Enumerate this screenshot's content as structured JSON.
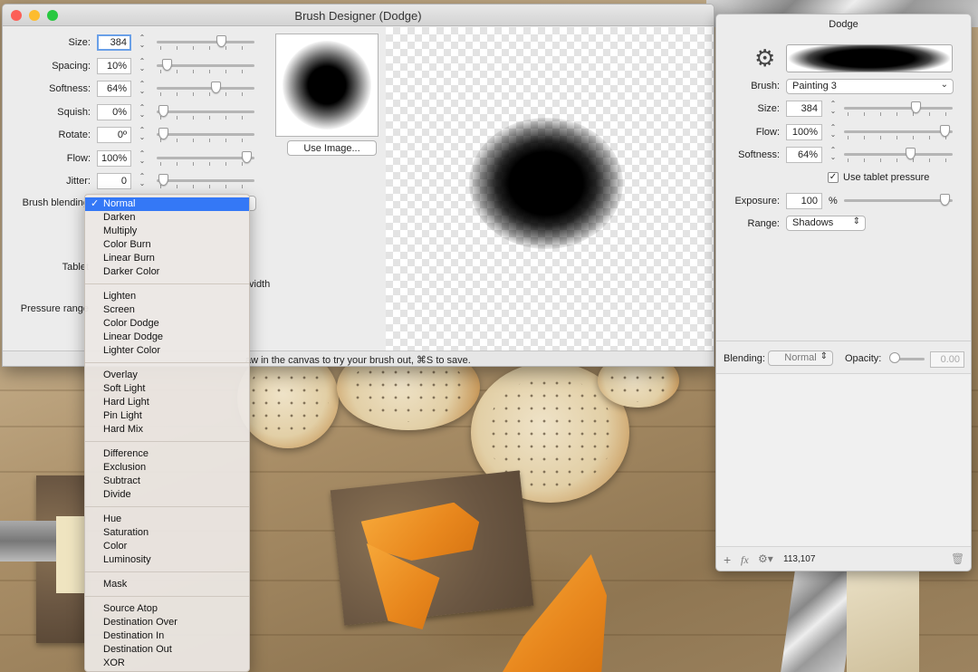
{
  "brush_designer": {
    "title": "Brush Designer (Dodge)",
    "rows": [
      {
        "label": "Size:",
        "value": "384",
        "slider": 0.68,
        "focused": true
      },
      {
        "label": "Spacing:",
        "value": "10%",
        "slider": 0.06
      },
      {
        "label": "Softness:",
        "value": "64%",
        "slider": 0.62
      },
      {
        "label": "Squish:",
        "value": "0%",
        "slider": 0.02
      },
      {
        "label": "Rotate:",
        "value": "0º",
        "slider": 0.02
      },
      {
        "label": "Flow:",
        "value": "100%",
        "slider": 0.97
      },
      {
        "label": "Jitter:",
        "value": "0",
        "slider": 0.02
      }
    ],
    "blending_label": "Brush blending",
    "tablet_label": "Tablet",
    "width_text": "vidth",
    "pressure_label": "Pressure range",
    "use_image_button": "Use Image...",
    "status_text": "aw in the canvas to try your brush out, ⌘S to save."
  },
  "blend_menu": {
    "selected": "Normal",
    "groups": [
      [
        "Normal",
        "Darken",
        "Multiply",
        "Color Burn",
        "Linear Burn",
        "Darker Color"
      ],
      [
        "Lighten",
        "Screen",
        "Color Dodge",
        "Linear Dodge",
        "Lighter Color"
      ],
      [
        "Overlay",
        "Soft Light",
        "Hard Light",
        "Pin Light",
        "Hard Mix"
      ],
      [
        "Difference",
        "Exclusion",
        "Subtract",
        "Divide"
      ],
      [
        "Hue",
        "Saturation",
        "Color",
        "Luminosity"
      ],
      [
        "Mask"
      ],
      [
        "Source Atop",
        "Destination Over",
        "Destination In",
        "Destination Out",
        "XOR"
      ]
    ]
  },
  "dodge_panel": {
    "title": "Dodge",
    "brush_label": "Brush:",
    "brush_value": "Painting 3",
    "rows": [
      {
        "label": "Size:",
        "value": "384",
        "slider": 0.68
      },
      {
        "label": "Flow:",
        "value": "100%",
        "slider": 0.97
      },
      {
        "label": "Softness:",
        "value": "64%",
        "slider": 0.62
      }
    ],
    "tablet_pressure": {
      "label": "Use tablet pressure",
      "checked": true
    },
    "exposure": {
      "label": "Exposure:",
      "value": "100",
      "unit": "%",
      "slider": 0.97
    },
    "range": {
      "label": "Range:",
      "value": "Shadows"
    },
    "blending": {
      "label": "Blending:",
      "value": "Normal"
    },
    "opacity": {
      "label": "Opacity:",
      "value": "0.00",
      "slider": 0.02
    },
    "coords": "113,107"
  },
  "colors": {
    "accent": "#3478f6",
    "close": "#fc5f57",
    "minimize": "#fdbc2e",
    "zoom": "#28c840"
  }
}
